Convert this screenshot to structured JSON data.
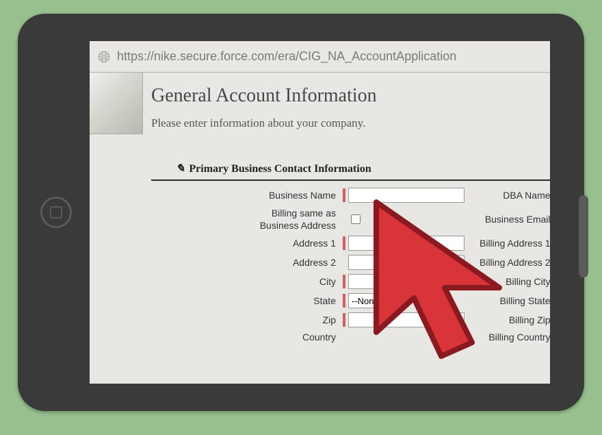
{
  "url": "https://nike.secure.force.com/era/CIG_NA_AccountApplication",
  "page": {
    "title": "General Account Information",
    "subtitle": "Please enter information about your company."
  },
  "section": {
    "title": "Primary Business Contact Information"
  },
  "form": {
    "left": {
      "business_name": "Business Name",
      "billing_same_line1": "Billing same as",
      "billing_same_line2": "Business Address",
      "address1": "Address 1",
      "address2": "Address 2",
      "city": "City",
      "state": "State",
      "zip": "Zip",
      "country": "Country"
    },
    "right": {
      "dba_name": "DBA Name",
      "business_email": "Business Email",
      "billing_address1": "Billing Address 1",
      "billing_address2": "Billing Address 2",
      "billing_city": "Billing City",
      "billing_state": "Billing State",
      "billing_zip": "Billing Zip",
      "billing_country": "Billing Country"
    },
    "values": {
      "business_name": "",
      "address1": "",
      "address2": "",
      "city": "",
      "zip": "",
      "state_selected": "--None--"
    }
  }
}
